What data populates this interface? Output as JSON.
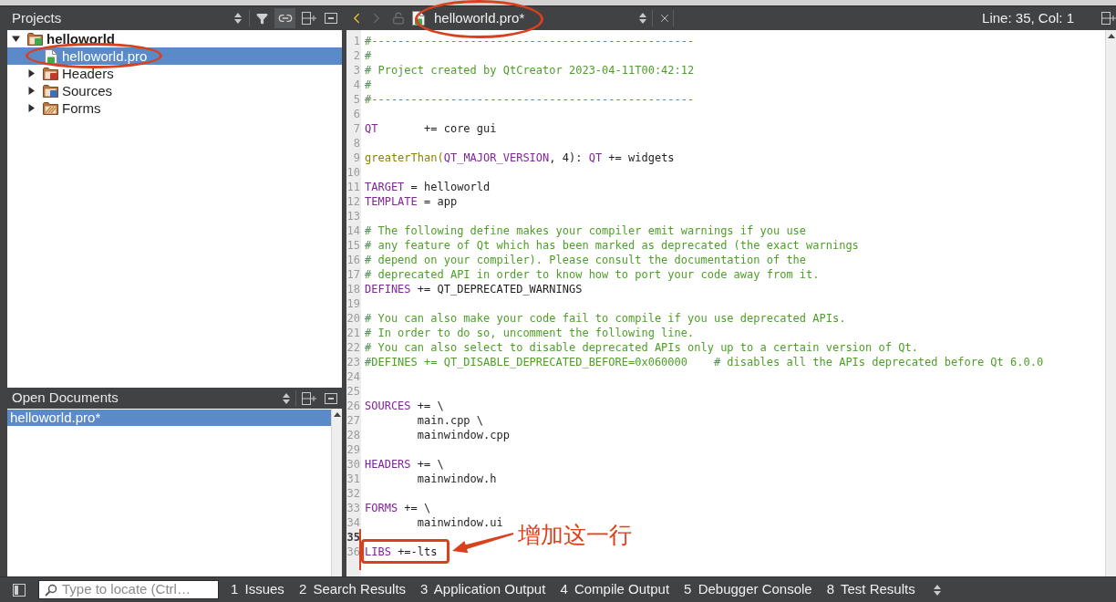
{
  "projects_pane": {
    "title": "Projects",
    "link_toggle": {
      "on": true
    },
    "tree": [
      {
        "label": "helloworld",
        "kind": "project",
        "expanded": true,
        "selected": false,
        "circled": false,
        "children": [
          {
            "label": "helloworld.pro",
            "kind": "pro_file",
            "selected": true,
            "circled": true
          },
          {
            "label": "Headers",
            "kind": "headers",
            "expanded": false,
            "selected": false,
            "circled": false
          },
          {
            "label": "Sources",
            "kind": "sources",
            "expanded": false,
            "selected": false,
            "circled": false
          },
          {
            "label": "Forms",
            "kind": "forms",
            "expanded": false,
            "selected": false,
            "circled": false
          }
        ]
      }
    ]
  },
  "open_documents": {
    "title": "Open Documents",
    "items": [
      {
        "label": "helloworld.pro*",
        "selected": true
      }
    ]
  },
  "editor": {
    "back_enabled": true,
    "forward_enabled": false,
    "document": {
      "title": "helloworld.pro*",
      "circled": true
    },
    "cursor_position": "Line: 35, Col: 1",
    "lines": [
      {
        "number": "1",
        "current": false,
        "boxed": false,
        "segments": [
          {
            "kind": "comment",
            "text": "#-------------------------------------------------"
          }
        ]
      },
      {
        "number": "2",
        "current": false,
        "boxed": false,
        "segments": [
          {
            "kind": "comment",
            "text": "#"
          }
        ]
      },
      {
        "number": "3",
        "current": false,
        "boxed": false,
        "segments": [
          {
            "kind": "comment",
            "text": "# Project created by QtCreator 2023-04-11T00:42:12"
          }
        ]
      },
      {
        "number": "4",
        "current": false,
        "boxed": false,
        "segments": [
          {
            "kind": "comment",
            "text": "#"
          }
        ]
      },
      {
        "number": "5",
        "current": false,
        "boxed": false,
        "segments": [
          {
            "kind": "comment",
            "text": "#-------------------------------------------------"
          }
        ]
      },
      {
        "number": "6",
        "current": false,
        "boxed": false
      },
      {
        "number": "7",
        "current": false,
        "boxed": false,
        "segments": [
          {
            "kind": "variable",
            "text": "QT"
          },
          {
            "kind": "plain",
            "text": "       += core gui"
          }
        ]
      },
      {
        "number": "8",
        "current": false,
        "boxed": false
      },
      {
        "number": "9",
        "current": false,
        "boxed": false,
        "segments": [
          {
            "kind": "function",
            "text": "greaterThan("
          },
          {
            "kind": "variable",
            "text": "QT_MAJOR_VERSION"
          },
          {
            "kind": "plain",
            "text": ", 4): "
          },
          {
            "kind": "variable",
            "text": "QT"
          },
          {
            "kind": "plain",
            "text": " += widgets"
          }
        ]
      },
      {
        "number": "10",
        "current": false,
        "boxed": false
      },
      {
        "number": "11",
        "current": false,
        "boxed": false,
        "segments": [
          {
            "kind": "variable",
            "text": "TARGET"
          },
          {
            "kind": "plain",
            "text": " = helloworld"
          }
        ]
      },
      {
        "number": "12",
        "current": false,
        "boxed": false,
        "segments": [
          {
            "kind": "variable",
            "text": "TEMPLATE"
          },
          {
            "kind": "plain",
            "text": " = app"
          }
        ]
      },
      {
        "number": "13",
        "current": false,
        "boxed": false
      },
      {
        "number": "14",
        "current": false,
        "boxed": false,
        "segments": [
          {
            "kind": "comment",
            "text": "# The following define makes your compiler emit warnings if you use"
          }
        ]
      },
      {
        "number": "15",
        "current": false,
        "boxed": false,
        "segments": [
          {
            "kind": "comment",
            "text": "# any feature of Qt which has been marked as deprecated (the exact warnings"
          }
        ]
      },
      {
        "number": "16",
        "current": false,
        "boxed": false,
        "segments": [
          {
            "kind": "comment",
            "text": "# depend on your compiler). Please consult the documentation of the"
          }
        ]
      },
      {
        "number": "17",
        "current": false,
        "boxed": false,
        "segments": [
          {
            "kind": "comment",
            "text": "# deprecated API in order to know how to port your code away from it."
          }
        ]
      },
      {
        "number": "18",
        "current": false,
        "boxed": false,
        "segments": [
          {
            "kind": "variable",
            "text": "DEFINES"
          },
          {
            "kind": "plain",
            "text": " += QT_DEPRECATED_WARNINGS"
          }
        ]
      },
      {
        "number": "19",
        "current": false,
        "boxed": false
      },
      {
        "number": "20",
        "current": false,
        "boxed": false,
        "segments": [
          {
            "kind": "comment",
            "text": "# You can also make your code fail to compile if you use deprecated APIs."
          }
        ]
      },
      {
        "number": "21",
        "current": false,
        "boxed": false,
        "segments": [
          {
            "kind": "comment",
            "text": "# In order to do so, uncomment the following line."
          }
        ]
      },
      {
        "number": "22",
        "current": false,
        "boxed": false,
        "segments": [
          {
            "kind": "comment",
            "text": "# You can also select to disable deprecated APIs only up to a certain version of Qt."
          }
        ]
      },
      {
        "number": "23",
        "current": false,
        "boxed": false,
        "segments": [
          {
            "kind": "comment",
            "text": "#DEFINES += QT_DISABLE_DEPRECATED_BEFORE=0x060000    # disables all the APIs deprecated before Qt 6.0.0"
          }
        ]
      },
      {
        "number": "24",
        "current": false,
        "boxed": false
      },
      {
        "number": "25",
        "current": false,
        "boxed": false
      },
      {
        "number": "26",
        "current": false,
        "boxed": false,
        "segments": [
          {
            "kind": "variable",
            "text": "SOURCES"
          },
          {
            "kind": "plain",
            "text": " += \\"
          }
        ]
      },
      {
        "number": "27",
        "current": false,
        "boxed": false,
        "segments": [
          {
            "kind": "plain",
            "text": "        main.cpp \\"
          }
        ]
      },
      {
        "number": "28",
        "current": false,
        "boxed": false,
        "segments": [
          {
            "kind": "plain",
            "text": "        mainwindow.cpp"
          }
        ]
      },
      {
        "number": "29",
        "current": false,
        "boxed": false
      },
      {
        "number": "30",
        "current": false,
        "boxed": false,
        "segments": [
          {
            "kind": "variable",
            "text": "HEADERS"
          },
          {
            "kind": "plain",
            "text": " += \\"
          }
        ]
      },
      {
        "number": "31",
        "current": false,
        "boxed": false,
        "segments": [
          {
            "kind": "plain",
            "text": "        mainwindow.h"
          }
        ]
      },
      {
        "number": "32",
        "current": false,
        "boxed": false
      },
      {
        "number": "33",
        "current": false,
        "boxed": false,
        "segments": [
          {
            "kind": "variable",
            "text": "FORMS"
          },
          {
            "kind": "plain",
            "text": " += \\"
          }
        ]
      },
      {
        "number": "34",
        "current": false,
        "boxed": false,
        "segments": [
          {
            "kind": "plain",
            "text": "        mainwindow.ui"
          }
        ]
      },
      {
        "number": "35",
        "current": true,
        "boxed": false
      },
      {
        "number": "36",
        "current": false,
        "boxed": true,
        "note": "增加这一行",
        "segments": [
          {
            "kind": "variable",
            "text": "LIBS"
          },
          {
            "kind": "plain",
            "text": " +=-lts"
          }
        ]
      }
    ]
  },
  "status_bar": {
    "locate": {
      "placeholder": "Type to locate (Ctrl…"
    },
    "panes": [
      {
        "number": "1",
        "label": "Issues"
      },
      {
        "number": "2",
        "label": "Search Results"
      },
      {
        "number": "3",
        "label": "Application Output"
      },
      {
        "number": "4",
        "label": "Compile Output"
      },
      {
        "number": "5",
        "label": "Debugger Console"
      },
      {
        "number": "8",
        "label": "Test Results"
      }
    ]
  }
}
